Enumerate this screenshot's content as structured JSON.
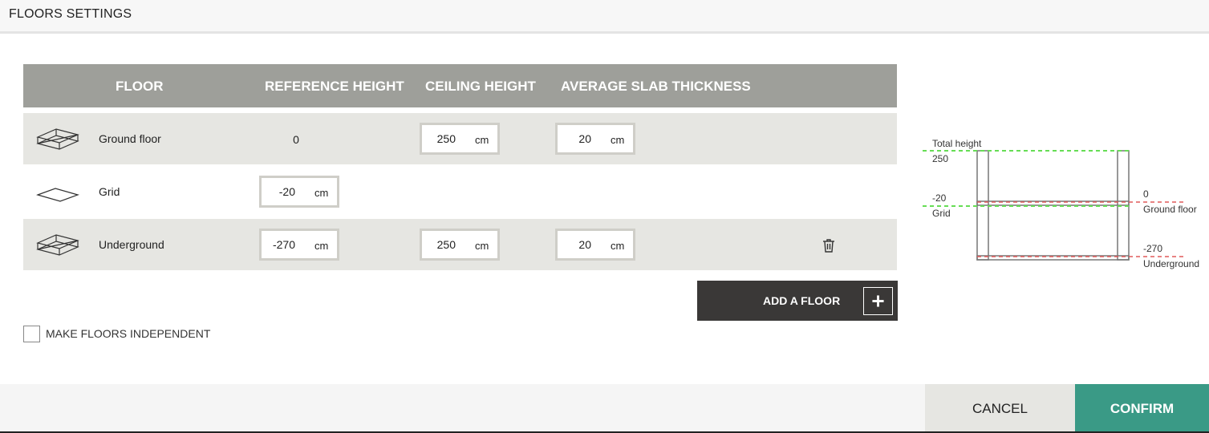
{
  "dialog": {
    "title": "FLOORS SETTINGS"
  },
  "table": {
    "headers": {
      "floor": "FLOOR",
      "reference_height": "REFERENCE HEIGHT",
      "ceiling_height": "CEILING HEIGHT",
      "average_slab_thickness": "AVERAGE SLAB THICKNESS"
    },
    "rows": [
      {
        "name": "Ground floor",
        "icon": "floor-box-icon",
        "reference_height": "0",
        "ceiling_height": "250",
        "ceiling_unit": "cm",
        "slab_thickness": "20",
        "slab_unit": "cm"
      },
      {
        "name": "Grid",
        "icon": "grid-plane-icon",
        "reference_height": "-20",
        "reference_unit": "cm"
      },
      {
        "name": "Underground",
        "icon": "floor-box-icon",
        "reference_height": "-270",
        "reference_unit": "cm",
        "ceiling_height": "250",
        "ceiling_unit": "cm",
        "slab_thickness": "20",
        "slab_unit": "cm",
        "action_icon": "trash-icon"
      }
    ]
  },
  "actions": {
    "add_floor_label": "ADD A FLOOR",
    "add_floor_icon": "plus-icon",
    "independent_label": "MAKE FLOORS INDEPENDENT",
    "independent_checked": false,
    "cancel_label": "CANCEL",
    "confirm_label": "CONFIRM"
  },
  "diagram": {
    "total_height_label": "Total height",
    "total_height_value": "250",
    "grid_value": "-20",
    "grid_label": "Grid",
    "ground_value": "0",
    "ground_label": "Ground floor",
    "underground_value": "-270",
    "underground_label": "Underground"
  },
  "colors": {
    "header_bg": "#9e9f9a",
    "row_shaded": "#e6e6e2",
    "add_button": "#3a3837",
    "confirm": "#3a9a86",
    "cancel": "#e6e6e2",
    "green_dashed": "#66dd55",
    "red_dashed": "#e05a5a"
  }
}
